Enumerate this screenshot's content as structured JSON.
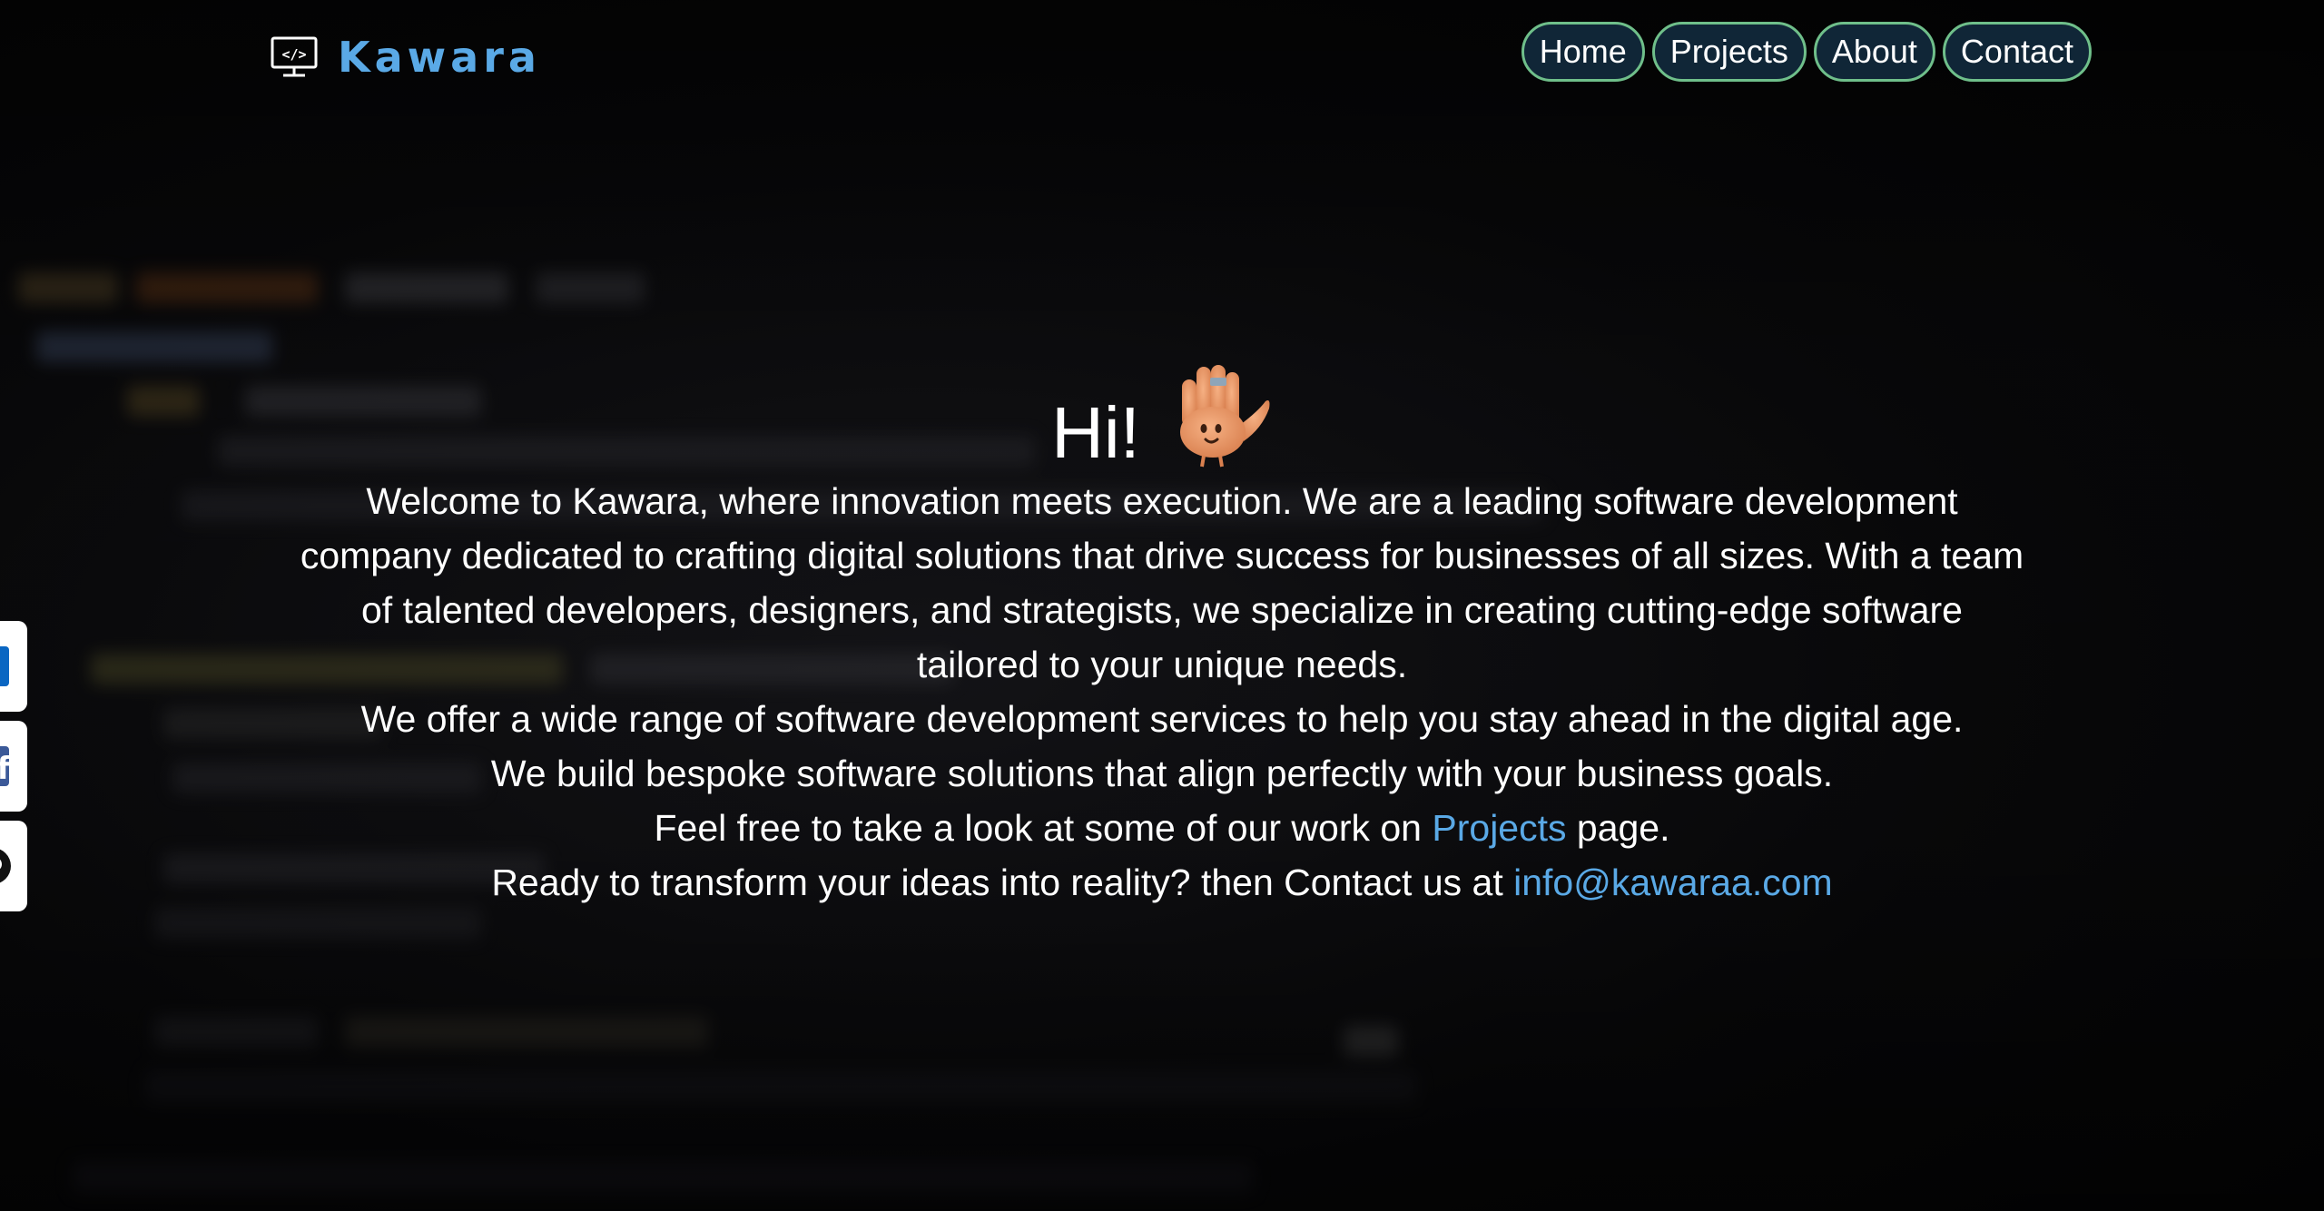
{
  "header": {
    "logo_text": "Kawara",
    "logo_icon": "monitor-code-icon",
    "nav": [
      {
        "label": "Home"
      },
      {
        "label": "Projects"
      },
      {
        "label": "About"
      },
      {
        "label": "Contact"
      }
    ]
  },
  "hero": {
    "title": "Hi!",
    "emoji_icon": "waving-hand-icon",
    "intro": "Welcome to Kawara, where innovation meets execution. We are a leading software development company dedicated to crafting digital solutions that drive success for businesses of all sizes. With a team of talented developers, designers, and strategists, we specialize in creating cutting-edge software tailored to your unique needs.",
    "services": "We offer a wide range of software development services to help you stay ahead in the digital age.",
    "bespoke": "We build bespoke software solutions that align perfectly with your business goals.",
    "projects_before": "Feel free to take a look at some of our work on ",
    "projects_link": "Projects",
    "projects_after": " page.",
    "contact_before": "Ready to transform your ideas into reality? then Contact us at ",
    "contact_email": "info@kawaraa.com"
  },
  "social": [
    {
      "icon": "linkedin-icon"
    },
    {
      "icon": "facebook-icon"
    },
    {
      "icon": "github-icon"
    }
  ],
  "colors": {
    "accent": "#5aa9e6",
    "nav_border": "#6fbf8a",
    "nav_bg": "#102637"
  }
}
